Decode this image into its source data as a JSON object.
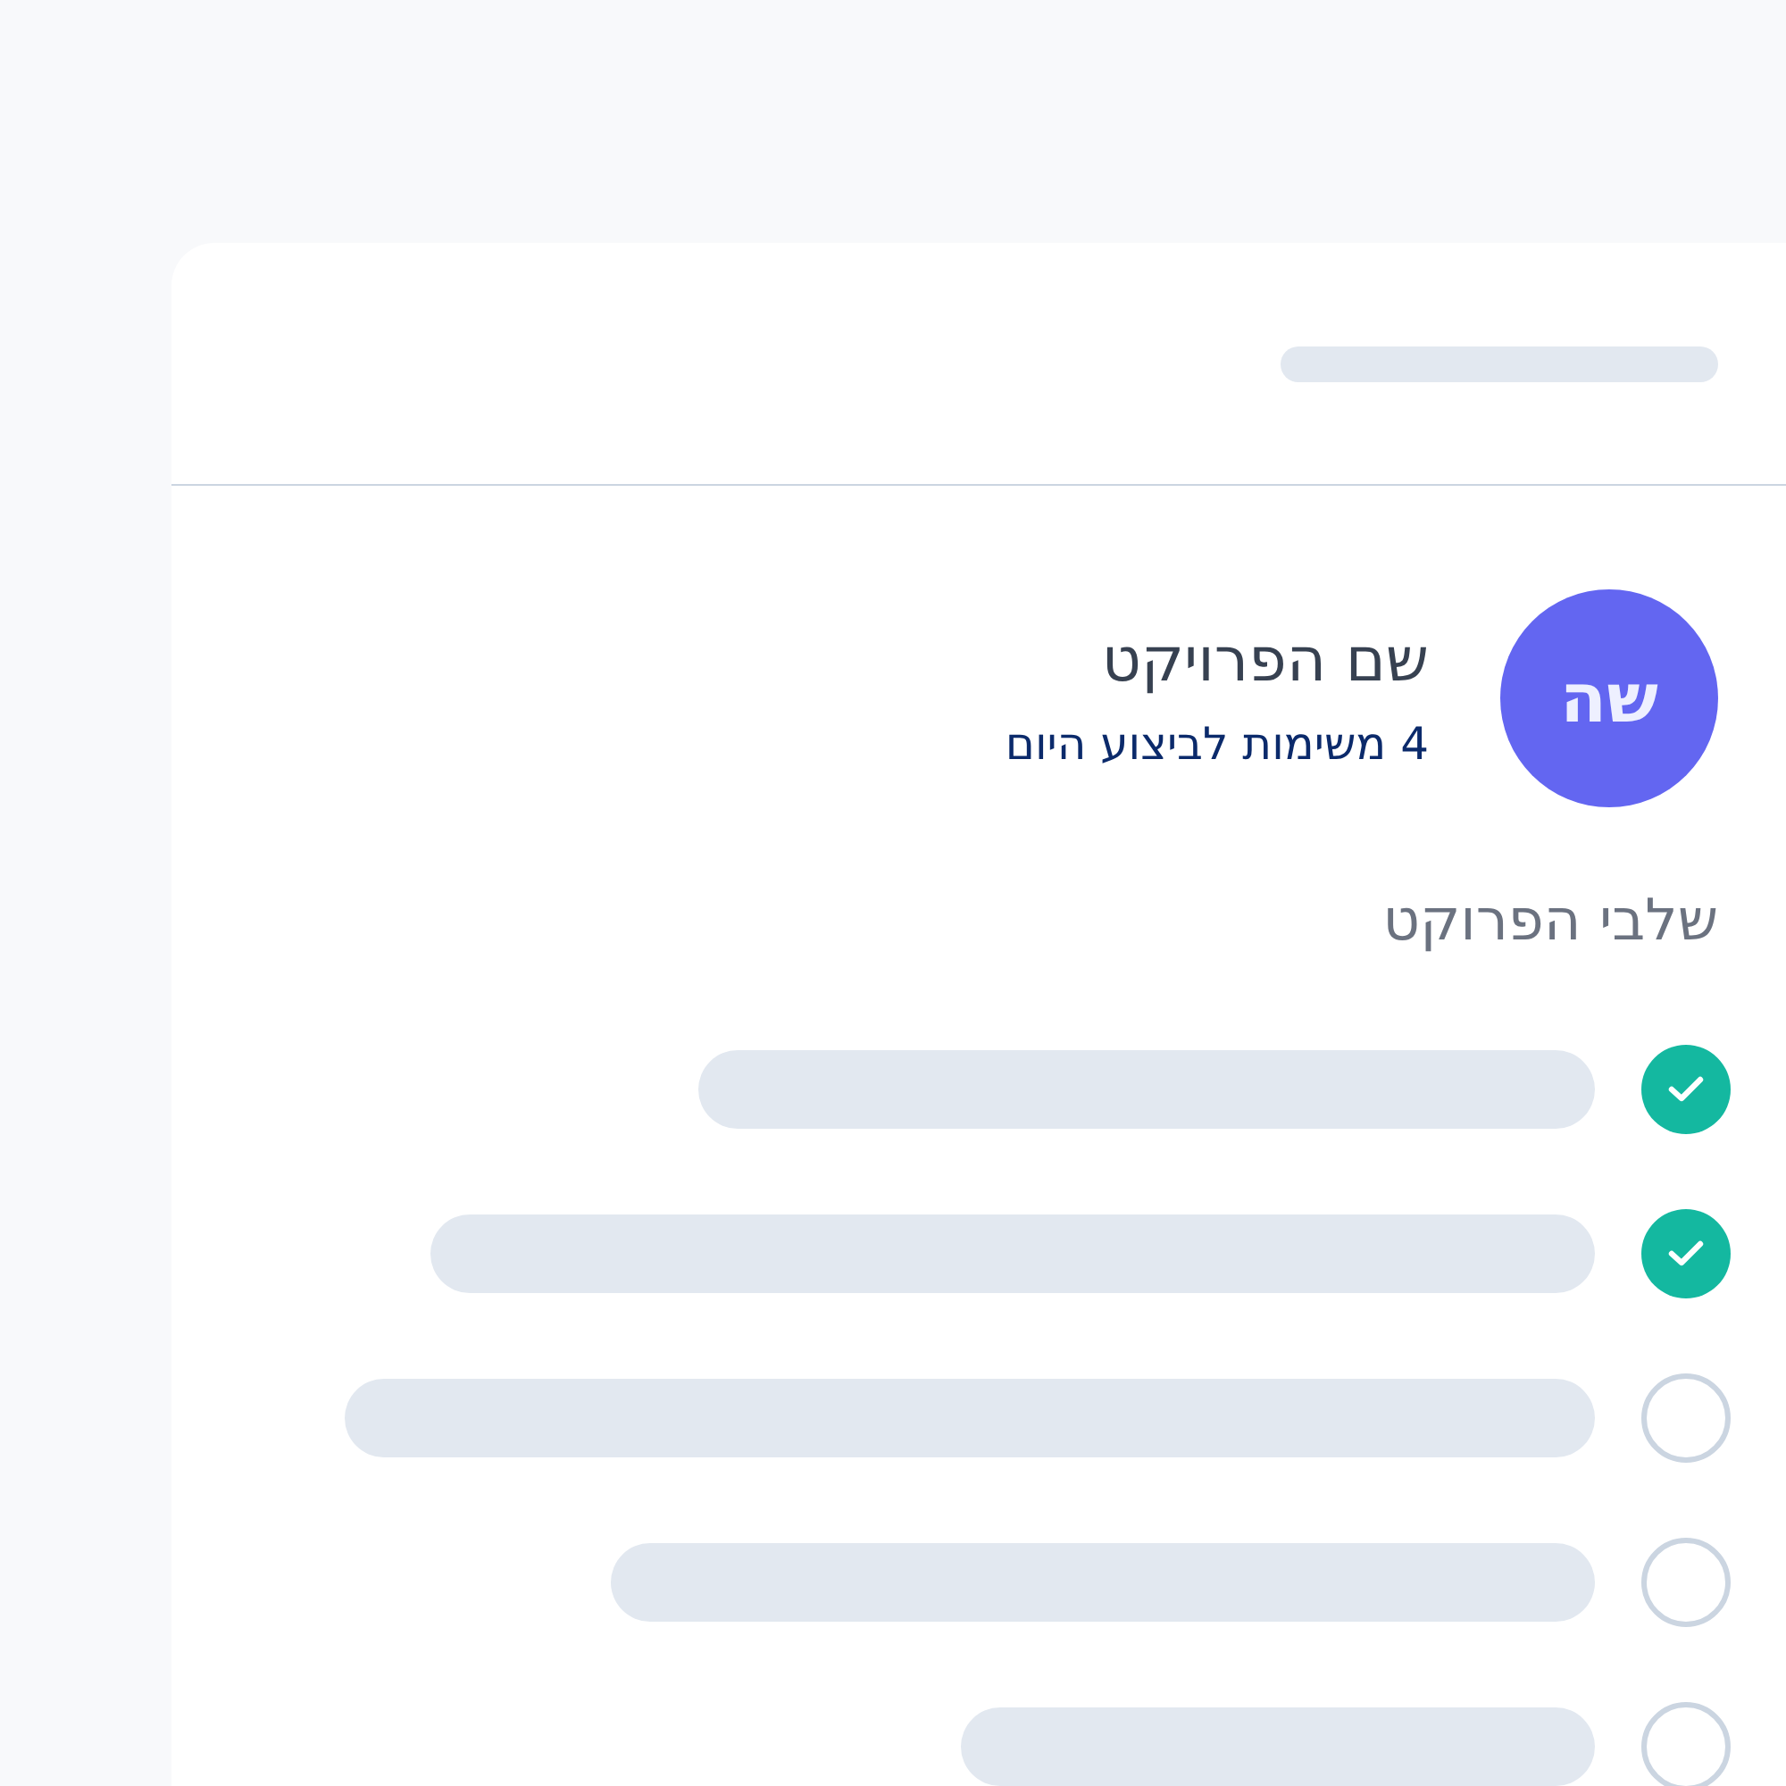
{
  "avatar": {
    "initials": "שה"
  },
  "project": {
    "title": "שם הפרויקט",
    "subtitle": "4 משימות לביצוע היום"
  },
  "steps_heading": "שלבי הפרוקט",
  "steps": [
    {
      "checked": true
    },
    {
      "checked": true
    },
    {
      "checked": false
    },
    {
      "checked": false
    },
    {
      "checked": false
    }
  ]
}
